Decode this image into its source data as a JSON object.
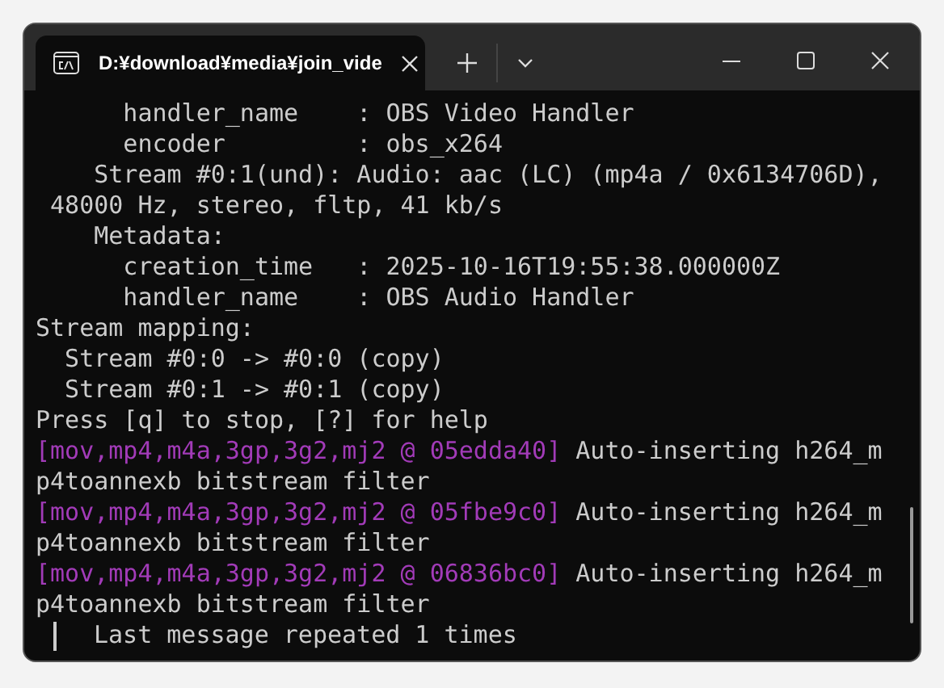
{
  "window": {
    "tab_title": "D:¥download¥media¥join_vide"
  },
  "lines": [
    {
      "kind": "plain",
      "text": "      handler_name    : OBS Video Handler"
    },
    {
      "kind": "plain",
      "text": "      encoder         : obs_x264"
    },
    {
      "kind": "plain",
      "text": "    Stream #0:1(und): Audio: aac (LC) (mp4a / 0x6134706D),"
    },
    {
      "kind": "plain",
      "text": " 48000 Hz, stereo, fltp, 41 kb/s"
    },
    {
      "kind": "plain",
      "text": "    Metadata:"
    },
    {
      "kind": "plain",
      "text": "      creation_time   : 2025-10-16T19:55:38.000000Z"
    },
    {
      "kind": "plain",
      "text": "      handler_name    : OBS Audio Handler"
    },
    {
      "kind": "plain",
      "text": "Stream mapping:"
    },
    {
      "kind": "plain",
      "text": "  Stream #0:0 -> #0:0 (copy)"
    },
    {
      "kind": "plain",
      "text": "  Stream #0:1 -> #0:1 (copy)"
    },
    {
      "kind": "plain",
      "text": "Press [q] to stop, [?] for help"
    },
    {
      "kind": "tagged",
      "tag": "[mov,mp4,m4a,3gp,3g2,mj2 @ 05edda40]",
      "text": " Auto-inserting h264_m"
    },
    {
      "kind": "plain",
      "text": "p4toannexb bitstream filter"
    },
    {
      "kind": "tagged",
      "tag": "[mov,mp4,m4a,3gp,3g2,mj2 @ 05fbe9c0]",
      "text": " Auto-inserting h264_m"
    },
    {
      "kind": "plain",
      "text": "p4toannexb bitstream filter"
    },
    {
      "kind": "tagged",
      "tag": "[mov,mp4,m4a,3gp,3g2,mj2 @ 06836bc0]",
      "text": " Auto-inserting h264_m"
    },
    {
      "kind": "plain",
      "text": "p4toannexb bitstream filter"
    },
    {
      "kind": "cursor",
      "text": "Last message repeated 1 times"
    }
  ]
}
